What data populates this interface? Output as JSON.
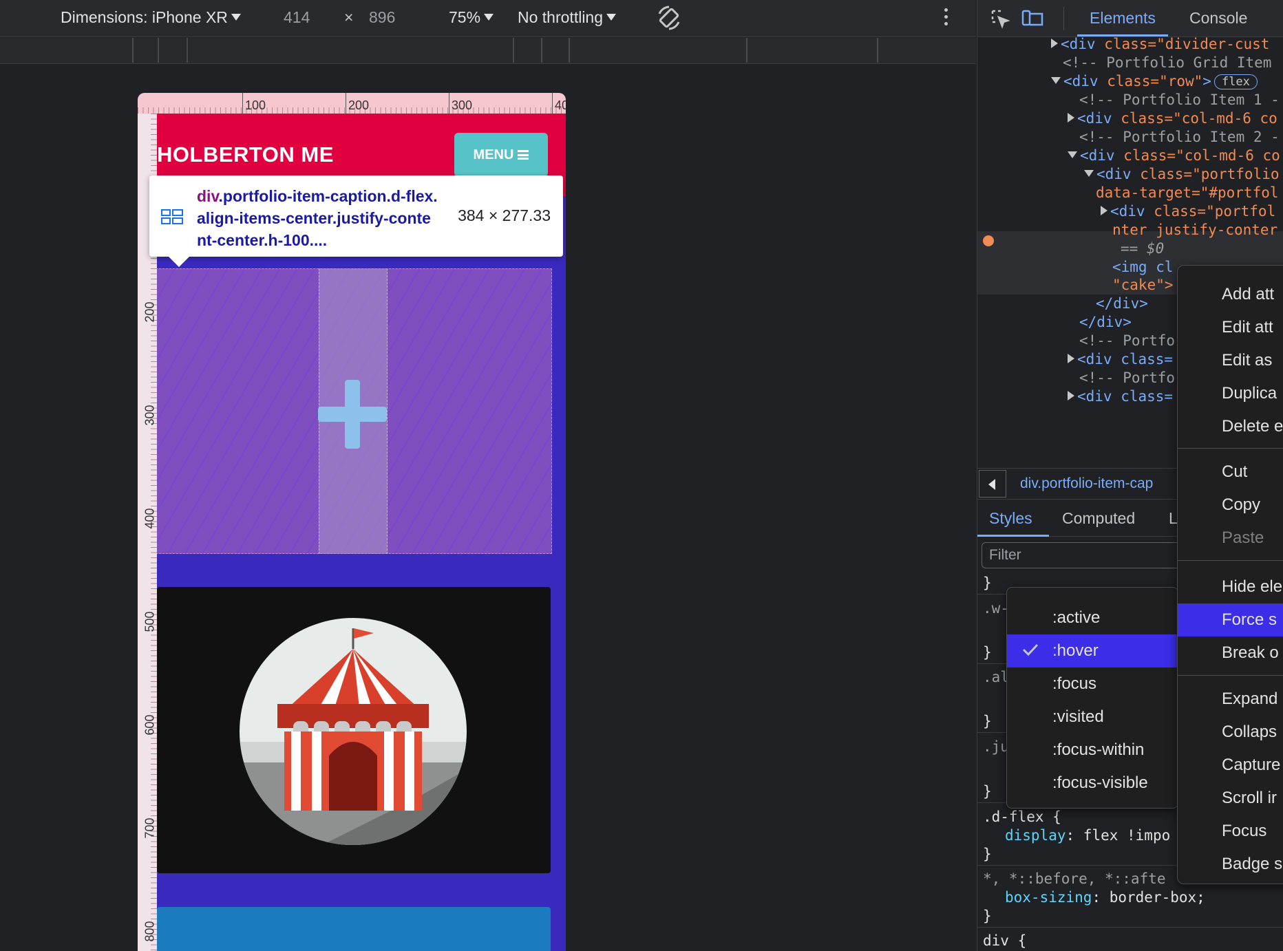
{
  "device_toolbar": {
    "dimensions_label": "Dimensions: iPhone XR",
    "width": "414",
    "times": "×",
    "height": "896",
    "zoom": "75%",
    "throttling": "No throttling",
    "rotate_icon": "rotate-icon",
    "more_icon": "kebab-icon"
  },
  "rulers": {
    "top": [
      "100",
      "200",
      "300",
      "40"
    ],
    "left": [
      "200",
      "300",
      "400",
      "500",
      "600",
      "700",
      "800"
    ]
  },
  "site": {
    "brand": "HOLBERTON ME",
    "menu": "MENU"
  },
  "tooltip": {
    "tag": "div",
    "selector": ".portfolio-item-caption.d-flex.align-items-center.justify-content-center.h-100....",
    "size": "384 × 277.33"
  },
  "devtools": {
    "tabs": [
      "Elements",
      "Console"
    ],
    "dom": {
      "l1_tag": "<div ",
      "l1_attr": "class=",
      "l1_val": "\"divider-cust",
      "l2": "<!-- Portfolio Grid Item",
      "l3_tag": "<div ",
      "l3_attr": "class=",
      "l3_val": "\"row\"",
      "l3_end": ">",
      "l3_badge": "flex",
      "l4": "<!-- Portfolio Item 1 -",
      "l5_tag": "<div ",
      "l5_attr": "class=",
      "l5_val": "\"col-md-6 co",
      "l6": "<!-- Portfolio Item 2 -",
      "l7_tag": "<div ",
      "l7_attr": "class=",
      "l7_val": "\"col-md-6 co",
      "l8_tag": "<div ",
      "l8_attr": "class=",
      "l8_val": "\"portfolio",
      "l9": "data-target=\"#portfol",
      "l10_tag": "<div ",
      "l10_attr": "class=",
      "l10_val": "\"portfol",
      "l11": "nter justify-conter",
      "l12": "== $0",
      "l13_tag": "<img cl",
      "l14": "\"cake\">",
      "l15": "</div>",
      "l16": "</div>",
      "l17": "<!-- Portfo",
      "l18_tag": "<div class=",
      "l19": "<!-- Portfo",
      "l20_tag": "<div class="
    },
    "breadcrumb": "div.portfolio-item-cap",
    "style_tabs": [
      "Styles",
      "Computed",
      "L"
    ],
    "filter_placeholder": "Filter",
    "css": {
      "c1": "}",
      "c2": ".w-",
      "c3": "}",
      "c4": ".al",
      "c5": "}",
      "c6": ".ju",
      "c7": "}",
      "c8": ".d-flex {",
      "c9_prop": "display",
      "c9_val": ": flex !impo",
      "c10": "}",
      "c11": "*, *::before, *::afte",
      "c12_prop": "box-sizing",
      "c12_val": ": border-box;",
      "c13": "}",
      "c14": "div {"
    }
  },
  "pseudo_menu": [
    ":active",
    ":hover",
    ":focus",
    ":visited",
    ":focus-within",
    ":focus-visible"
  ],
  "context_menu": [
    "Add att",
    "Edit att",
    "Edit as",
    "Duplica",
    "Delete e",
    "Cut",
    "Copy",
    "Paste",
    "Hide ele",
    "Force s",
    "Break o",
    "Expand",
    "Collaps",
    "Capture",
    "Scroll ir",
    "Focus",
    "Badge s"
  ],
  "colors": {
    "accent": "#7cacf8",
    "highlight": "#3c2ee8",
    "brand_red": "#e0003f",
    "teal": "#57c3c8",
    "page_blue": "#3a29bd"
  }
}
